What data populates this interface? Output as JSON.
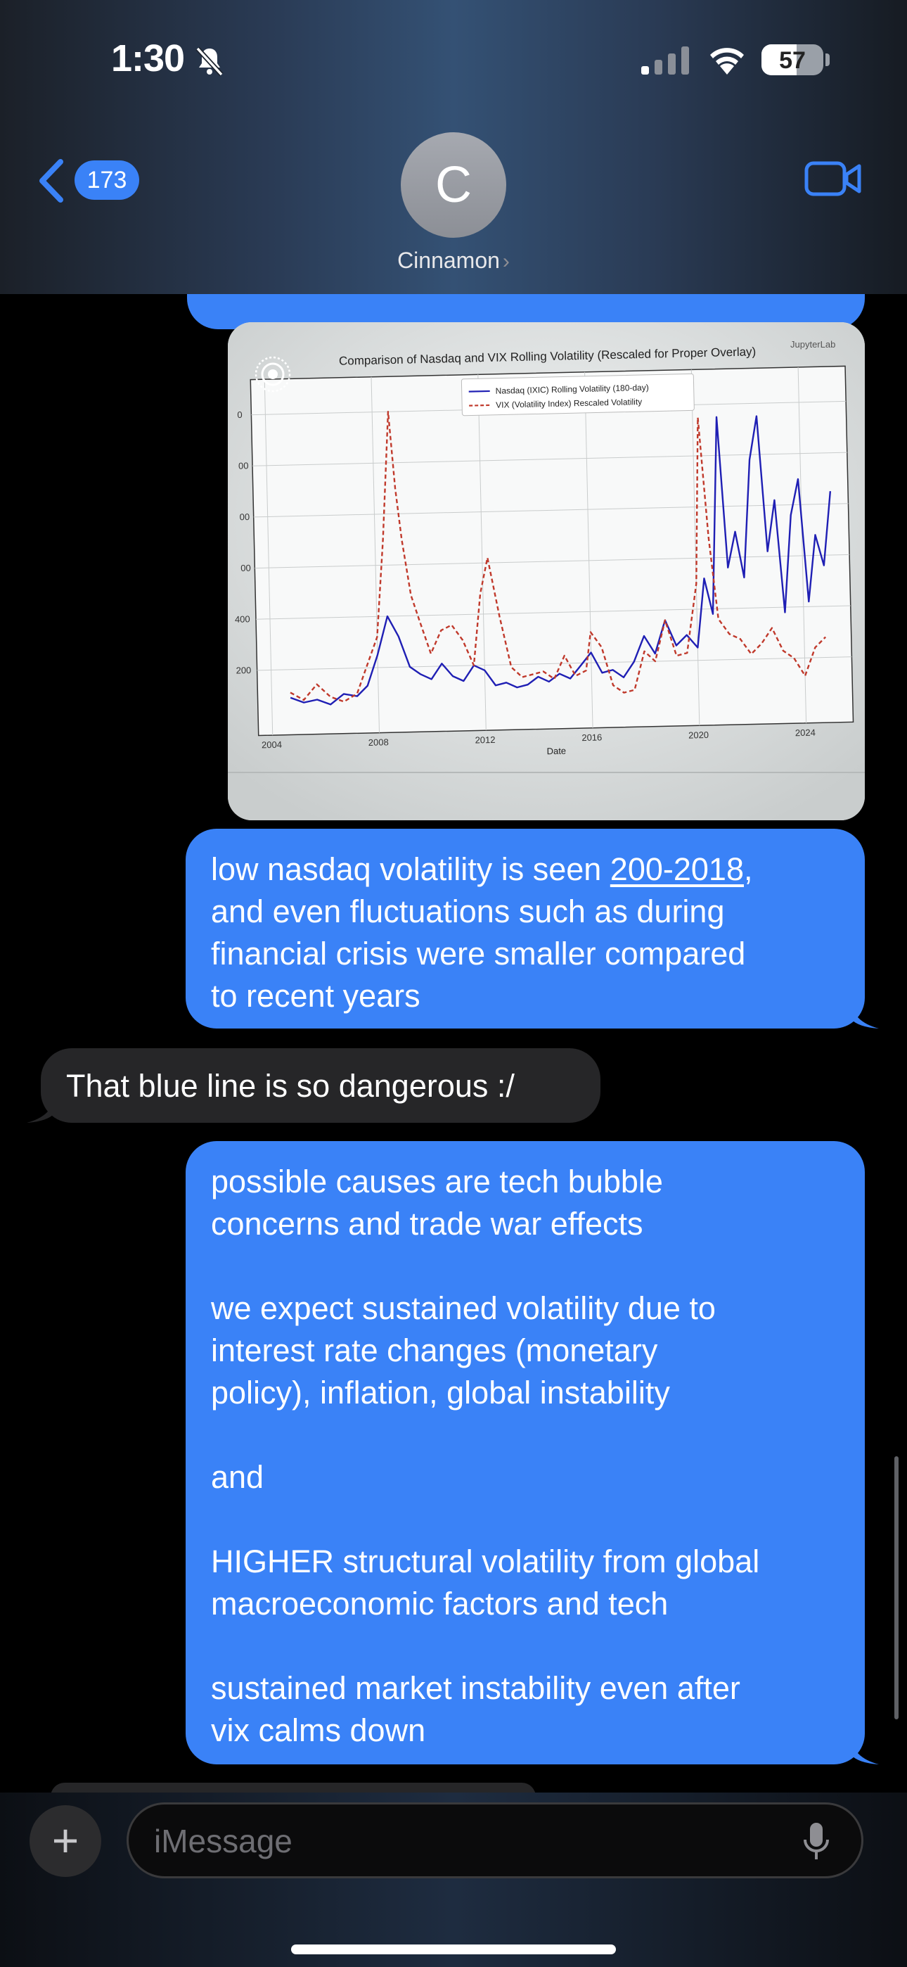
{
  "status_bar": {
    "time": "1:30",
    "battery": "57",
    "battery_level": 0.57
  },
  "header": {
    "back_count": "173",
    "avatar_initial": "C",
    "contact_name": "Cinnamon",
    "name_chevron": "›"
  },
  "photo": {
    "header_text": "JupyterLab",
    "chart_data": {
      "type": "line",
      "title": "Comparison of Nasdaq and VIX Rolling Volatility (Rescaled for Proper Overlay)",
      "xlabel": "Date",
      "ylabel": "",
      "x_ticks": [
        "2004",
        "2008",
        "2012",
        "2016",
        "2020",
        "2024"
      ],
      "y_ticks": [
        "200",
        "400",
        "00",
        "00",
        "00",
        "0"
      ],
      "xlim": [
        2004,
        2025.5
      ],
      "ylim": [
        0,
        1200
      ],
      "legend_position": "top-center",
      "grid": true,
      "series": [
        {
          "name": "Nasdaq (IXIC) Rolling Volatility (180-day)",
          "style": "solid",
          "color": "#1f1fb4",
          "x": [
            2004.7,
            2005.2,
            2005.7,
            2006.2,
            2006.7,
            2007.2,
            2007.6,
            2008.0,
            2008.4,
            2008.8,
            2009.2,
            2009.6,
            2010.0,
            2010.4,
            2010.8,
            2011.2,
            2011.6,
            2012.0,
            2012.4,
            2012.8,
            2013.2,
            2013.6,
            2014.0,
            2014.4,
            2014.8,
            2015.2,
            2015.6,
            2016.0,
            2016.4,
            2016.8,
            2017.2,
            2017.6,
            2018.0,
            2018.4,
            2018.8,
            2019.2,
            2019.6,
            2020.0,
            2020.3,
            2020.6,
            2020.9,
            2021.2,
            2021.5,
            2021.8,
            2022.1,
            2022.4,
            2022.7,
            2023.0,
            2023.3,
            2023.6,
            2023.9,
            2024.2,
            2024.5,
            2024.8,
            2025.1
          ],
          "y": [
            90,
            70,
            80,
            60,
            100,
            90,
            130,
            250,
            400,
            320,
            200,
            170,
            150,
            210,
            160,
            140,
            200,
            180,
            120,
            130,
            110,
            120,
            150,
            130,
            160,
            140,
            190,
            240,
            160,
            170,
            140,
            200,
            300,
            230,
            360,
            260,
            300,
            250,
            520,
            380,
            1150,
            560,
            700,
            520,
            980,
            1150,
            620,
            820,
            380,
            760,
            900,
            420,
            680,
            560,
            850
          ]
        },
        {
          "name": "VIX (Volatility Index) Rescaled Volatility",
          "style": "dashed",
          "color": "#c0392b",
          "x": [
            2004.7,
            2005.2,
            2005.7,
            2006.2,
            2006.7,
            2007.2,
            2007.6,
            2008.0,
            2008.3,
            2008.6,
            2008.8,
            2009.0,
            2009.3,
            2009.6,
            2010.0,
            2010.4,
            2010.8,
            2011.2,
            2011.6,
            2011.9,
            2012.2,
            2012.6,
            2013.0,
            2013.4,
            2013.8,
            2014.2,
            2014.6,
            2015.0,
            2015.4,
            2015.8,
            2016.0,
            2016.4,
            2016.8,
            2017.2,
            2017.6,
            2018.0,
            2018.4,
            2018.8,
            2019.2,
            2019.6,
            2020.0,
            2020.2,
            2020.5,
            2020.8,
            2021.2,
            2021.6,
            2022.0,
            2022.4,
            2022.8,
            2023.2,
            2023.6,
            2024.0,
            2024.4,
            2024.8
          ],
          "y": [
            110,
            80,
            140,
            90,
            70,
            100,
            210,
            320,
            700,
            1200,
            900,
            700,
            480,
            380,
            250,
            340,
            360,
            300,
            200,
            480,
            620,
            390,
            190,
            150,
            160,
            170,
            140,
            230,
            150,
            170,
            320,
            260,
            110,
            80,
            90,
            240,
            200,
            360,
            220,
            230,
            500,
            1150,
            680,
            360,
            300,
            280,
            220,
            260,
            320,
            230,
            200,
            130,
            240,
            280
          ]
        }
      ]
    }
  },
  "messages": [
    {
      "id": "m1",
      "direction": "sent",
      "text_before": "low nasdaq volatility is seen ",
      "link": "200-2018",
      "text_after": ",\nand even fluctuations such as during\nfinancial crisis were smaller compared\nto recent years"
    },
    {
      "id": "m2",
      "direction": "received",
      "text": "That blue line is so dangerous :/"
    },
    {
      "id": "m3",
      "direction": "sent",
      "text": "possible causes are tech bubble\nconcerns and trade war effects\n\nwe expect sustained volatility due to\ninterest rate changes (monetary\npolicy), inflation, global instability\n\nand\n\nHIGHER structural volatility from global\nmacroeconomic factors and tech\n\nsustained market instability even after\nvix calms down"
    }
  ],
  "composer": {
    "placeholder": "iMessage",
    "value": "",
    "plus_label": "+"
  },
  "icons": {
    "bell": "bell-slash-icon",
    "signal": "cellular-signal-icon",
    "wifi": "wifi-icon",
    "battery": "battery-icon",
    "back": "chevron-left-icon",
    "video": "video-camera-icon",
    "live_photo": "live-photo-icon",
    "mic": "microphone-icon"
  },
  "colors": {
    "sent_bubble": "#3a82f7",
    "received_bubble": "#262628",
    "accent": "#3a82f7"
  }
}
